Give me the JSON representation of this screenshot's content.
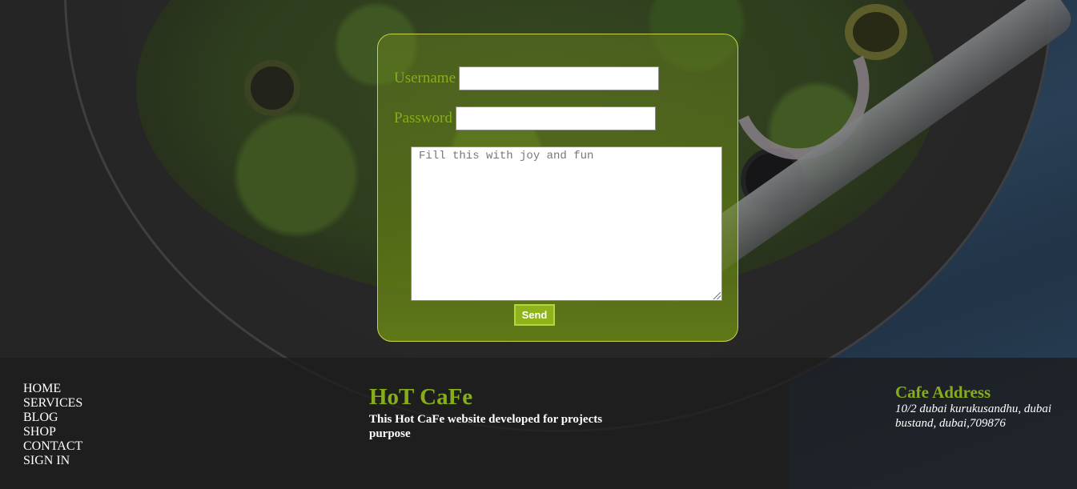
{
  "form": {
    "username_label": "Username",
    "username_value": "",
    "password_label": "Password",
    "password_value": "",
    "message_placeholder": "Fill this with joy and fun",
    "send_label": "Send"
  },
  "footer": {
    "nav": [
      "HOME",
      "SERVICES",
      "BLOG",
      "SHOP",
      "CONTACT",
      "SIGN IN"
    ],
    "brand_title": "HoT CaFe",
    "brand_description": "This Hot CaFe website developed for projects purpose",
    "address_title": "Cafe Address",
    "address_text": "10/2 dubai kurukusandhu, dubai bustand, dubai,709876"
  },
  "colors": {
    "accent": "#86ad1a",
    "button": "#8fb31a"
  }
}
